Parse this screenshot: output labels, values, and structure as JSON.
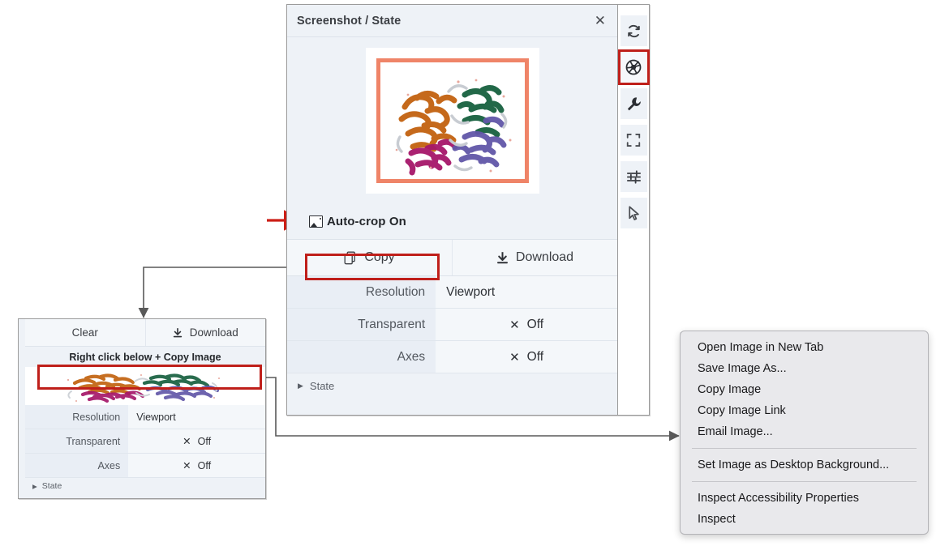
{
  "main_panel": {
    "title": "Screenshot / State",
    "close_icon": "close-icon",
    "screenshot_alt": "protein-ribbon-structure",
    "autocrop": {
      "icon": "image-icon",
      "label": "Auto-crop On"
    },
    "buttons": [
      {
        "icon": "copy-icon",
        "label": "Copy",
        "highlighted": true
      },
      {
        "icon": "download-icon",
        "label": "Download",
        "highlighted": false
      }
    ],
    "settings": [
      {
        "key": "Resolution",
        "value": "Viewport",
        "icon": "",
        "centered": false
      },
      {
        "key": "Transparent",
        "value": "Off",
        "icon": "x-icon",
        "centered": true
      },
      {
        "key": "Axes",
        "value": "Off",
        "icon": "x-icon",
        "centered": true
      }
    ],
    "state_row": {
      "triangle": "triangle-right-icon",
      "label": "State"
    }
  },
  "toolbar": {
    "items": [
      {
        "name": "refresh-icon",
        "selected": false
      },
      {
        "name": "camera-aperture-icon",
        "selected": true
      },
      {
        "name": "wrench-icon",
        "selected": false
      },
      {
        "name": "fullscreen-icon",
        "selected": false
      },
      {
        "name": "sliders-icon",
        "selected": false
      },
      {
        "name": "cursor-pointer-icon",
        "selected": false
      }
    ]
  },
  "mini_panel": {
    "buttons": [
      {
        "icon": "",
        "label": "Clear"
      },
      {
        "icon": "download-icon",
        "label": "Download"
      }
    ],
    "hint": "Right click below + Copy Image",
    "thumbnail_alt": "protein-ribbon-structure-thumbnail",
    "settings": [
      {
        "key": "Resolution",
        "value": "Viewport",
        "icon": "",
        "centered": false
      },
      {
        "key": "Transparent",
        "value": "Off",
        "icon": "x-icon",
        "centered": true
      },
      {
        "key": "Axes",
        "value": "Off",
        "icon": "x-icon",
        "centered": true
      }
    ],
    "state_row": {
      "triangle": "triangle-right-icon",
      "label": "State"
    }
  },
  "context_menu": {
    "groups": [
      [
        "Open Image in New Tab",
        "Save Image As...",
        "Copy Image",
        "Copy Image Link",
        "Email Image..."
      ],
      [
        "Set Image as Desktop Background..."
      ],
      [
        "Inspect Accessibility Properties",
        "Inspect"
      ]
    ]
  },
  "annotations": {
    "highlight_color": "#bf1f1a",
    "arrow_color": "#cc1f16",
    "wire_color": "#595959",
    "screenshot_frame_color": "#ef8468"
  }
}
